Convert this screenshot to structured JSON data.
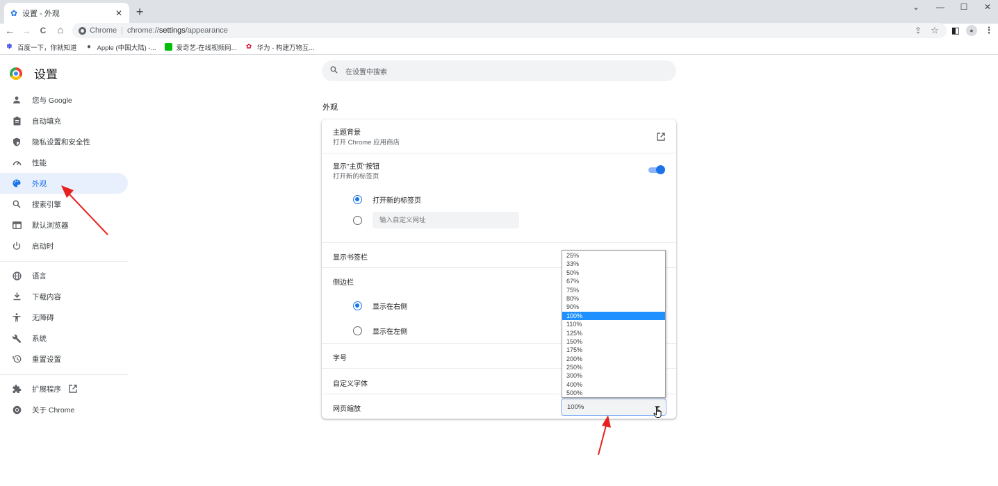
{
  "browser": {
    "tab": {
      "title": "设置 - 外观",
      "icon": "gear-icon",
      "close_glyph": "✕"
    },
    "new_tab_glyph": "+",
    "window_controls": {
      "tab_search": "⌄",
      "minimize": "—",
      "maximize": "☐",
      "close": "✕"
    },
    "nav": {
      "back": "←",
      "forward": "→",
      "reload": "C",
      "home": "⌂"
    },
    "omnibox": {
      "site_label": "Chrome",
      "separator": "|",
      "url_scheme": "chrome://",
      "url_host": "settings",
      "url_path": "/appearance"
    },
    "toolbar_icons": {
      "share": "⇪",
      "bookmark": "☆",
      "side_panel": "◧",
      "profile": "●",
      "menu": "⋮"
    },
    "bookmarks": [
      {
        "label": "百度一下，你就知道",
        "icon": "baidu-icon",
        "glyph": "🐾",
        "color": "#2932e1"
      },
      {
        "label": "Apple (中国大陆) -...",
        "icon": "apple-icon",
        "glyph": "",
        "color": "#555555"
      },
      {
        "label": "爱奇艺-在线视频网...",
        "icon": "iqiyi-icon",
        "glyph": "■",
        "color": "#00be06"
      },
      {
        "label": "华为 - 构建万物互...",
        "icon": "huawei-icon",
        "glyph": "✿",
        "color": "#cf0a2c"
      }
    ]
  },
  "sidebar": {
    "title": "设置",
    "items": [
      {
        "label": "您与 Google",
        "icon": "person-icon",
        "glyph": "👤",
        "active": false
      },
      {
        "label": "自动填充",
        "icon": "clipboard-icon",
        "glyph": "📋",
        "active": false
      },
      {
        "label": "隐私设置和安全性",
        "icon": "shield-icon",
        "glyph": "⛊",
        "active": false
      },
      {
        "label": "性能",
        "icon": "speedometer-icon",
        "glyph": "◔",
        "active": false
      },
      {
        "label": "外观",
        "icon": "palette-icon",
        "glyph": "🎨",
        "active": true
      },
      {
        "label": "搜索引擎",
        "icon": "search-icon",
        "glyph": "🔍",
        "active": false
      },
      {
        "label": "默认浏览器",
        "icon": "browser-icon",
        "glyph": "▭",
        "active": false
      },
      {
        "label": "启动时",
        "icon": "power-icon",
        "glyph": "⏻",
        "active": false
      },
      {
        "label": "语言",
        "icon": "globe-icon",
        "glyph": "🌐",
        "active": false
      },
      {
        "label": "下载内容",
        "icon": "download-icon",
        "glyph": "⤓",
        "active": false
      },
      {
        "label": "无障碍",
        "icon": "accessibility-icon",
        "glyph": "♿",
        "active": false
      },
      {
        "label": "系统",
        "icon": "wrench-icon",
        "glyph": "🔧",
        "active": false
      },
      {
        "label": "重置设置",
        "icon": "history-icon",
        "glyph": "↺",
        "active": false
      },
      {
        "label": "扩展程序",
        "icon": "puzzle-icon",
        "glyph": "✱",
        "active": false,
        "external": true
      },
      {
        "label": "关于 Chrome",
        "icon": "chrome-icon",
        "glyph": "◉",
        "active": false
      }
    ]
  },
  "search": {
    "placeholder": "在设置中搜索"
  },
  "appearance": {
    "section_title": "外观",
    "theme": {
      "label": "主题背景",
      "sub": "打开 Chrome 应用商店"
    },
    "home_button": {
      "label": "显示\"主页\"按钮",
      "sub": "打开新的标签页",
      "enabled": true
    },
    "home_options": [
      {
        "label": "打开新的标签页",
        "checked": true
      },
      {
        "label": "",
        "placeholder": "输入自定义网址",
        "checked": false
      }
    ],
    "bookmarks_bar": {
      "label": "显示书签栏"
    },
    "side_panel": {
      "label": "侧边栏"
    },
    "side_panel_options": [
      {
        "label": "显示在右侧",
        "checked": true
      },
      {
        "label": "显示在左侧",
        "checked": false
      }
    ],
    "font_size": {
      "label": "字号"
    },
    "custom_fonts": {
      "label": "自定义字体"
    },
    "page_zoom": {
      "label": "网页缩放",
      "value": "100%",
      "options": [
        "25%",
        "33%",
        "50%",
        "67%",
        "75%",
        "80%",
        "90%",
        "100%",
        "110%",
        "125%",
        "150%",
        "175%",
        "200%",
        "250%",
        "300%",
        "400%",
        "500%"
      ],
      "highlighted": "100%"
    }
  },
  "colors": {
    "accent": "#1a73e8",
    "active_bg": "#e8f0fe",
    "dropdown_highlight": "#1e90ff",
    "annotation_arrow": "#e8201e"
  }
}
